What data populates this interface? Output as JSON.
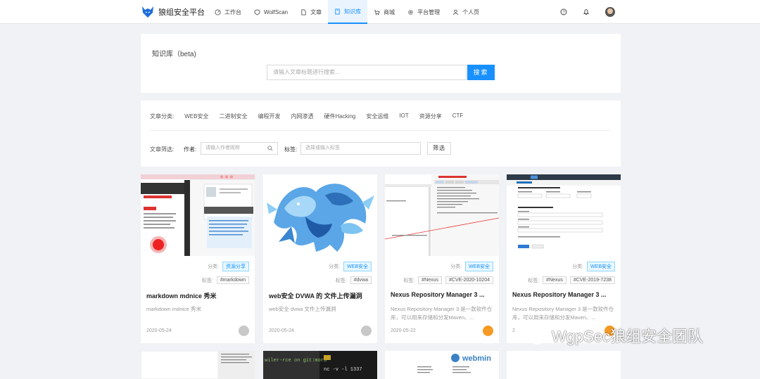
{
  "brand": {
    "name": "狼组安全平台"
  },
  "nav": {
    "items": [
      {
        "label": "工作台",
        "icon": "dashboard-icon"
      },
      {
        "label": "WolfScan",
        "icon": "shield-icon"
      },
      {
        "label": "文章",
        "icon": "file-icon"
      },
      {
        "label": "知识库",
        "icon": "book-icon"
      },
      {
        "label": "商城",
        "icon": "cart-icon"
      },
      {
        "label": "平台管理",
        "icon": "settings-icon"
      },
      {
        "label": "个人页",
        "icon": "user-icon"
      }
    ],
    "active": "知识库",
    "right_icons": [
      "help-icon",
      "bell-icon",
      "avatar"
    ]
  },
  "knowledge": {
    "title": "知识库（beta)",
    "search_placeholder": "请输入文章标题进行搜索...",
    "search_button": "搜索"
  },
  "filters": {
    "category_label": "文章分类:",
    "categories": [
      "WEB安全",
      "二进制安全",
      "编程开发",
      "内网渗透",
      "硬件Hacking",
      "安全运维",
      "IOT",
      "资源分享",
      "CTF"
    ],
    "filter_label": "文章筛选:",
    "author_label": "作者:",
    "author_placeholder": "请输入作者昵称",
    "tag_label": "标签:",
    "tag_placeholder": "选择或输入标签",
    "filter_button": "筛选"
  },
  "articles": [
    {
      "category_label": "分类:",
      "category": "资源分享",
      "tag_label": "标签:",
      "tags": [
        "#markdown"
      ],
      "title": "markdown mdnice 秀米",
      "desc": "markdown mdnice 秀米",
      "date": "2020-05-24"
    },
    {
      "category_label": "分类:",
      "category": "WEB安全",
      "tag_label": "标签:",
      "tags": [
        "#dvwa"
      ],
      "title": "web安全 DVWA 的 文件上传漏洞",
      "desc": "web安全 dvwa 文件上传漏洞",
      "date": "2020-05-24"
    },
    {
      "category_label": "分类:",
      "category": "WEB安全",
      "tag_label": "标签:",
      "tags": [
        "#Nexus",
        "#CVE-2020-10204"
      ],
      "title": "Nexus Repository Manager 3 ...",
      "desc": "Nexus Repository Manager 3 是一款软件仓库，可以用来存储和分发Maven、...",
      "date": "2020-05-22"
    },
    {
      "category_label": "分类:",
      "category": "WEB安全",
      "tag_label": "标签:",
      "tags": [
        "#Nexus",
        "#CVE-2019-7238"
      ],
      "title": "Nexus Repository Manager 3 ...",
      "desc": "Nexus Repository Manager 3 是一款软件仓库，可以用来存储和分发Maven、...",
      "date": "2"
    }
  ],
  "bottom_cards": {
    "terminal_text": "wiler-rce on git:mord",
    "terminal_text2": "nc -v -l 1337",
    "webmin": "webmin"
  },
  "watermark": {
    "text": "WgpSec狼组安全团队"
  }
}
